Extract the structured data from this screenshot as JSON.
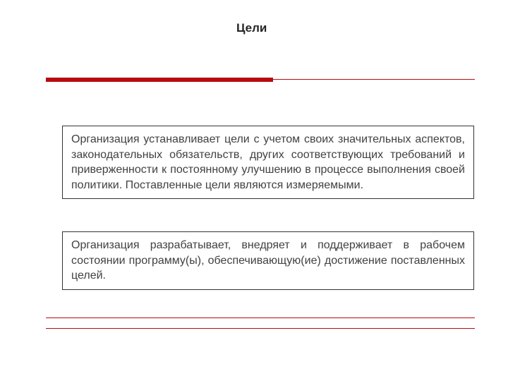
{
  "title": "Цели",
  "colors": {
    "accent": "#b90b0f",
    "text": "#414141",
    "title": "#252525"
  },
  "boxes": [
    {
      "text": "Организация устанавливает цели с учетом своих значительных аспектов, законодательных обязательств, других соответствующих требований и приверженности к постоянному улучшению в процессе выполнения своей политики. Поставленные цели являются измеряемыми."
    },
    {
      "text": "Организация разрабатывает, внедряет и поддерживает в рабочем состоянии программу(ы), обеспечивающую(ие) достижение поставленных целей."
    }
  ]
}
